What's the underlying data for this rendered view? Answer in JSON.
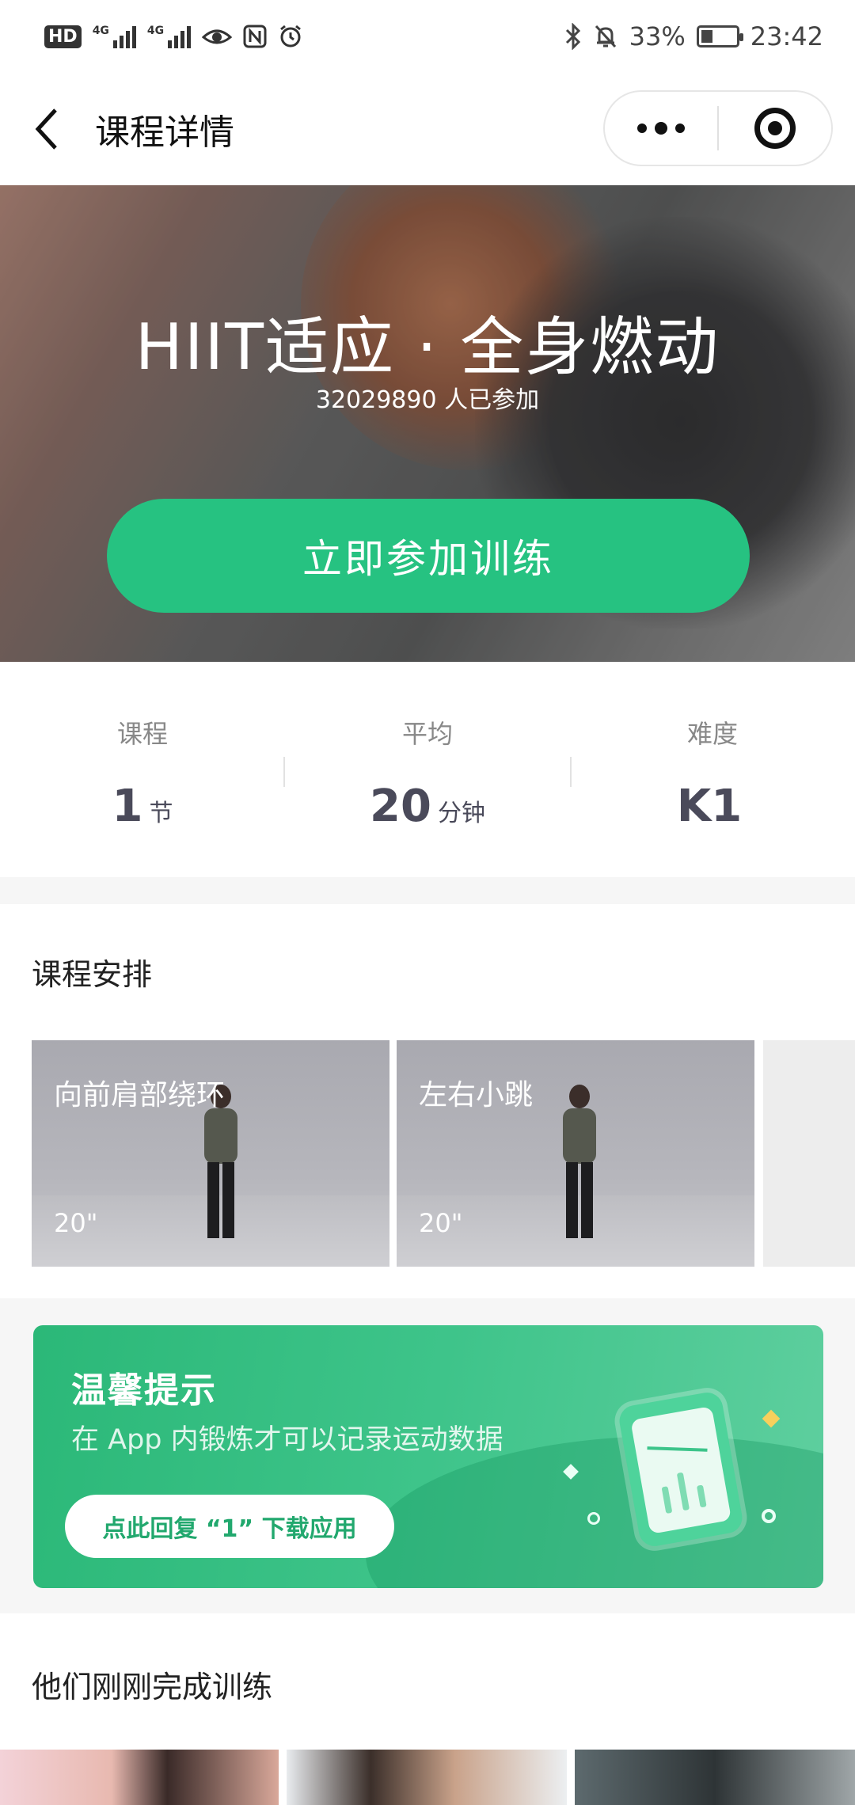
{
  "status_bar": {
    "hd": "HD",
    "network1": "4G",
    "network2": "4G",
    "battery_percent": "33%",
    "battery_level": 0.33,
    "time": "23:42"
  },
  "nav": {
    "title": "课程详情"
  },
  "hero": {
    "title": "HIIT适应 · 全身燃动",
    "participants": "32029890 人已参加",
    "join_button": "立即参加训练"
  },
  "stats": [
    {
      "label": "课程",
      "value": "1",
      "unit": "节"
    },
    {
      "label": "平均",
      "value": "20",
      "unit": "分钟"
    },
    {
      "label": "难度",
      "value": "K1",
      "unit": ""
    }
  ],
  "schedule": {
    "title": "课程安排",
    "items": [
      {
        "name": "向前肩部绕环",
        "duration": "20\""
      },
      {
        "name": "左右小跳",
        "duration": "20\""
      }
    ]
  },
  "tip": {
    "title": "温馨提示",
    "description": "在 App 内锻炼才可以记录运动数据",
    "button": "点此回复 “1” 下载应用"
  },
  "recent": {
    "title": "他们刚刚完成训练"
  },
  "colors": {
    "accent": "#26c281",
    "tip_background": "#2bb878"
  }
}
